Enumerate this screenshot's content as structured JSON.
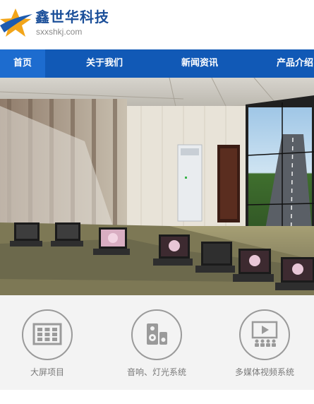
{
  "brand": {
    "title": "鑫世华科技",
    "domain": "sxxshkj.com"
  },
  "nav": {
    "items": [
      {
        "label": "首页"
      },
      {
        "label": "关于我们"
      },
      {
        "label": "新闻资讯"
      },
      {
        "label": "产品介绍"
      }
    ],
    "active_index": 0
  },
  "features": [
    {
      "label": "大屏项目",
      "icon": "video-wall-icon"
    },
    {
      "label": "音响、灯光系统",
      "icon": "speaker-icon"
    },
    {
      "label": "多媒体视频系统",
      "icon": "multimedia-icon"
    }
  ],
  "colors": {
    "nav_bg": "#1159b6",
    "nav_active": "#1d6ccf",
    "brand_text": "#1b4f99",
    "icon_gray": "#9a9a9a"
  }
}
